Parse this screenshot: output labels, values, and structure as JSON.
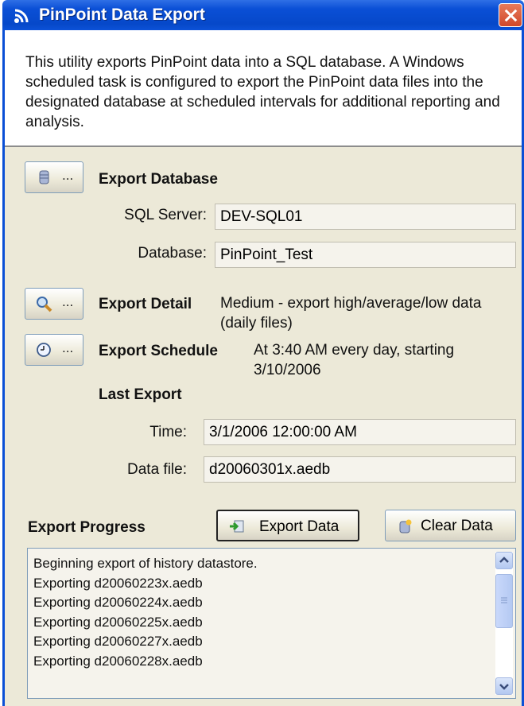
{
  "window": {
    "title": "PinPoint Data Export"
  },
  "intro": {
    "text": "This utility exports PinPoint data into a SQL database. A Windows scheduled task is configured to export the PinPoint data files into the designated database at scheduled intervals for additional reporting and analysis."
  },
  "export_database": {
    "heading": "Export Database",
    "button_ellipsis": "...",
    "sql_server_label": "SQL Server:",
    "sql_server_value": "DEV-SQL01",
    "database_label": "Database:",
    "database_value": "PinPoint_Test"
  },
  "export_detail": {
    "heading": "Export Detail",
    "button_ellipsis": "...",
    "value": "Medium - export high/average/low data (daily files)"
  },
  "export_schedule": {
    "heading": "Export Schedule",
    "button_ellipsis": "...",
    "value": "At 3:40 AM every day, starting 3/10/2006"
  },
  "last_export": {
    "heading": "Last Export",
    "time_label": "Time:",
    "time_value": "3/1/2006 12:00:00 AM",
    "data_file_label": "Data file:",
    "data_file_value": "d20060301x.aedb"
  },
  "progress": {
    "heading": "Export Progress",
    "export_button": "Export Data",
    "clear_button": "Clear Data",
    "log": [
      "Beginning export of history datastore.",
      "Exporting d20060223x.aedb",
      "Exporting d20060224x.aedb",
      "Exporting d20060225x.aedb",
      "Exporting d20060227x.aedb",
      "Exporting d20060228x.aedb"
    ]
  },
  "colors": {
    "titlebar": "#0a4fd6",
    "panel": "#ece9d8",
    "close": "#d0482a"
  },
  "icons": [
    "rss-icon",
    "close-icon",
    "database-icon",
    "magnifier-icon",
    "clock-icon",
    "export-arrow-icon",
    "clear-data-icon",
    "scroll-up-icon",
    "scroll-down-icon"
  ]
}
